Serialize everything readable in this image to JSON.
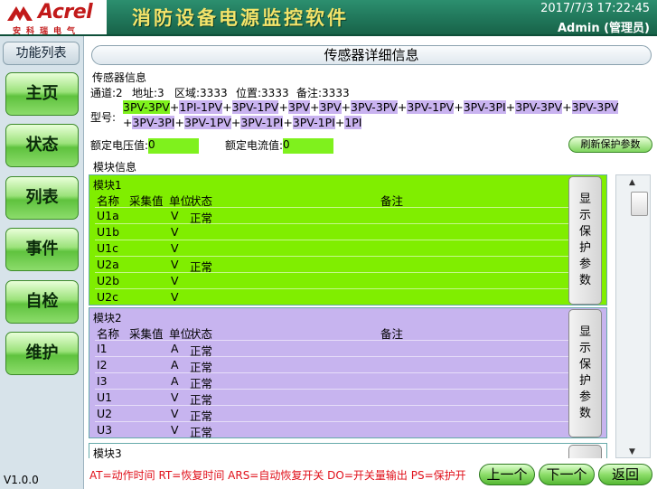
{
  "header": {
    "logo_text": "Acrel",
    "logo_sub": "安科瑞电气",
    "title": "消防设备电源监控软件",
    "datetime": "2017/7/3 17:22:45",
    "user": "Admin (管理员)"
  },
  "sidebar": {
    "title": "功能列表",
    "items": [
      {
        "label": "主页"
      },
      {
        "label": "状态"
      },
      {
        "label": "列表"
      },
      {
        "label": "事件"
      },
      {
        "label": "自检"
      },
      {
        "label": "维护"
      }
    ],
    "version": "V1.0.0"
  },
  "page_title": "传感器详细信息",
  "sensor": {
    "section_label": "传感器信息",
    "channel": "通道:2",
    "address": "地址:3",
    "zone": "区域:3333",
    "location": "位置:3333",
    "remark": "备注:3333",
    "model_label": "型号:",
    "model_tokens": [
      {
        "t": "3PV-3PV",
        "c": "g"
      },
      {
        "t": "+",
        "c": ""
      },
      {
        "t": "1PI-1PV",
        "c": "p"
      },
      {
        "t": "+",
        "c": ""
      },
      {
        "t": "3PV-1PV",
        "c": "p"
      },
      {
        "t": "+",
        "c": ""
      },
      {
        "t": "3PV",
        "c": "p"
      },
      {
        "t": "+",
        "c": ""
      },
      {
        "t": "3PV",
        "c": "p"
      },
      {
        "t": "+",
        "c": ""
      },
      {
        "t": "3PV-3PV",
        "c": "p"
      },
      {
        "t": "+",
        "c": ""
      },
      {
        "t": "3PV-1PV",
        "c": "p"
      },
      {
        "t": "+",
        "c": ""
      },
      {
        "t": "3PV-3PI",
        "c": "p"
      },
      {
        "t": "+",
        "c": ""
      },
      {
        "t": "3PV-3PV",
        "c": "p"
      },
      {
        "t": "+",
        "c": ""
      },
      {
        "t": "3PV-3PV",
        "c": "p"
      },
      {
        "t": " +",
        "c": ""
      },
      {
        "t": "3PV-3PI",
        "c": "p"
      },
      {
        "t": "+",
        "c": ""
      },
      {
        "t": "3PV-1PV",
        "c": "p"
      },
      {
        "t": "+",
        "c": ""
      },
      {
        "t": "3PV-1PI",
        "c": "p"
      },
      {
        "t": "+",
        "c": ""
      },
      {
        "t": "3PV-1PI",
        "c": "p"
      },
      {
        "t": "+",
        "c": ""
      },
      {
        "t": "1PI",
        "c": "p"
      }
    ],
    "rated_voltage_label": "额定电压值:",
    "rated_voltage": "0",
    "rated_current_label": "额定电流值:",
    "rated_current": "0",
    "refresh_label": "刷新保护参数"
  },
  "modules_label": "模块信息",
  "table_headers": {
    "name": "名称",
    "value": "采集值",
    "unit": "单位",
    "state": "状态",
    "note": "备注"
  },
  "modules": [
    {
      "name": "模块1",
      "color": "#80ee00",
      "rows": [
        {
          "name": "U1a",
          "value": "",
          "unit": "V",
          "state": "正常",
          "note": ""
        },
        {
          "name": "U1b",
          "value": "",
          "unit": "V",
          "state": "",
          "note": ""
        },
        {
          "name": "U1c",
          "value": "",
          "unit": "V",
          "state": "",
          "note": ""
        },
        {
          "name": "U2a",
          "value": "",
          "unit": "V",
          "state": "正常",
          "note": ""
        },
        {
          "name": "U2b",
          "value": "",
          "unit": "V",
          "state": "",
          "note": ""
        },
        {
          "name": "U2c",
          "value": "",
          "unit": "V",
          "state": "",
          "note": ""
        }
      ],
      "button": [
        "显",
        "示",
        "保",
        "护",
        "参",
        "数"
      ]
    },
    {
      "name": "模块2",
      "color": "#c7b4ef",
      "rows": [
        {
          "name": "I1",
          "value": "",
          "unit": "A",
          "state": "正常",
          "note": ""
        },
        {
          "name": "I2",
          "value": "",
          "unit": "A",
          "state": "正常",
          "note": ""
        },
        {
          "name": "I3",
          "value": "",
          "unit": "A",
          "state": "正常",
          "note": ""
        },
        {
          "name": "U1",
          "value": "",
          "unit": "V",
          "state": "正常",
          "note": ""
        },
        {
          "name": "U2",
          "value": "",
          "unit": "V",
          "state": "正常",
          "note": ""
        },
        {
          "name": "U3",
          "value": "",
          "unit": "V",
          "state": "正常",
          "note": ""
        }
      ],
      "button": [
        "显",
        "示",
        "保",
        "护",
        "参",
        "数"
      ]
    },
    {
      "name": "模块3",
      "color": "#ffffff",
      "rows": [],
      "button": []
    }
  ],
  "legend": "AT=动作时间  RT=恢复时间  ARS=自动恢复开关  DO=开关量输出  PS=保护开",
  "bottom_buttons": {
    "prev": "上一个",
    "next": "下一个",
    "back": "返回"
  },
  "colors": {
    "header_bg": "#1f7458",
    "title_yellow": "#f4e46a",
    "green_bar": "#80ee00",
    "purple_bar": "#c7b4ef",
    "legend_red": "#e0101a"
  }
}
